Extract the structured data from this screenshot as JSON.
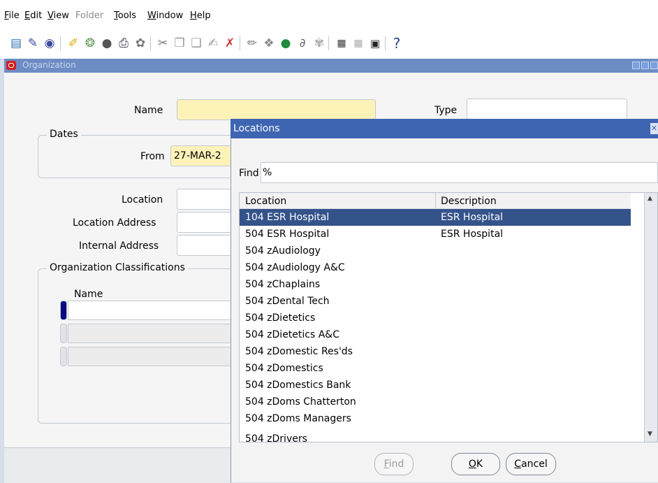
{
  "menu": [
    {
      "label": "File",
      "u": "F",
      "rest": "ile",
      "disabled": false
    },
    {
      "label": "Edit",
      "u": "E",
      "rest": "dit",
      "disabled": false
    },
    {
      "label": "View",
      "u": "V",
      "rest": "iew",
      "disabled": false
    },
    {
      "label": "Folder",
      "u": "",
      "rest": "Folder",
      "disabled": true
    },
    {
      "label": "Tools",
      "u": "T",
      "rest": "ools",
      "disabled": false
    },
    {
      "label": "Window",
      "u": "W",
      "rest": "indow",
      "disabled": false
    },
    {
      "label": "Help",
      "u": "H",
      "rest": "elp",
      "disabled": false
    }
  ],
  "toolbar": {
    "icons": [
      "new-record-icon",
      "find-icon",
      "navigator-icon",
      "open-icon",
      "save-and-proceed-icon",
      "switch-responsibility-icon",
      "print-icon",
      "close-form-icon",
      "cut-icon",
      "copy-icon",
      "paste-icon",
      "clear-record-icon",
      "delete-record-icon",
      "edit-field-icon",
      "zoom-icon",
      "translations-icon",
      "attachments-icon",
      "folder-tools-icon",
      "calendar-icon",
      "calendar-disabled-icon",
      "window-help-icon"
    ],
    "help_glyph": "?"
  },
  "org_window": {
    "title": "Organization",
    "name_label": "Name",
    "name_value": "",
    "type_label": "Type",
    "type_value": "",
    "dates_group": "Dates",
    "from_label": "From",
    "from_value": "27-MAR-2",
    "location_label": "Location",
    "location_address_label": "Location Address",
    "internal_address_label": "Internal Address",
    "classifications_group": "Organization Classifications",
    "classifications_name_header": "Name"
  },
  "lov": {
    "title": "Locations",
    "find_label": "Find",
    "find_value": "%",
    "columns": [
      "Location",
      "Description"
    ],
    "rows": [
      {
        "location": "104 ESR Hospital",
        "description": "ESR Hospital",
        "selected": true
      },
      {
        "location": "504 ESR Hospital",
        "description": "ESR Hospital",
        "selected": false
      },
      {
        "location": "504 zAudiology",
        "description": "",
        "selected": false
      },
      {
        "location": "504 zAudiology A&C",
        "description": "",
        "selected": false
      },
      {
        "location": "504 zChaplains",
        "description": "",
        "selected": false
      },
      {
        "location": "504 zDental Tech",
        "description": "",
        "selected": false
      },
      {
        "location": "504 zDietetics",
        "description": "",
        "selected": false
      },
      {
        "location": "504 zDietetics A&C",
        "description": "",
        "selected": false
      },
      {
        "location": "504 zDomestic Res'ds",
        "description": "",
        "selected": false
      },
      {
        "location": "504 zDomestics",
        "description": "",
        "selected": false
      },
      {
        "location": "504 zDomestics Bank",
        "description": "",
        "selected": false
      },
      {
        "location": "504 zDoms Chatterton",
        "description": "",
        "selected": false
      },
      {
        "location": "504 zDoms Managers",
        "description": "",
        "selected": false
      },
      {
        "location": "504 zDrivers",
        "description": "",
        "selected": false
      }
    ],
    "buttons": {
      "find": {
        "u": "F",
        "rest": "ind",
        "disabled": true
      },
      "ok": {
        "u": "O",
        "rest": "K"
      },
      "cancel": {
        "u": "C",
        "rest": "ancel"
      }
    }
  },
  "colors": {
    "selected_row": "#34538a",
    "lov_title": "#3d65b2",
    "required_field": "#fdf2b8"
  }
}
